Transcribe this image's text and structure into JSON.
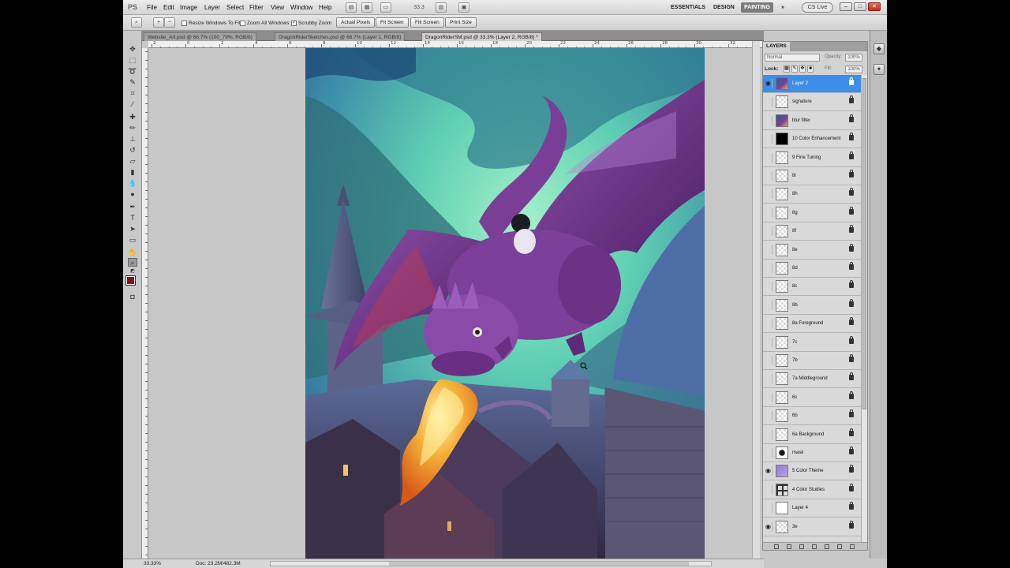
{
  "app": {
    "logo": "PS"
  },
  "menu": [
    "File",
    "Edit",
    "Image",
    "Layer",
    "Select",
    "Filter",
    "View",
    "Window",
    "Help"
  ],
  "zoom_menu_value": "33.3",
  "workspaces": [
    "ESSENTIALS",
    "DESIGN",
    "PAINTING"
  ],
  "workspace_more": "»",
  "cs_live": "CS Live",
  "window_controls": {
    "min": "–",
    "max": "□",
    "close": "✕"
  },
  "options": {
    "resize_windows": "Resize Windows To Fit",
    "zoom_all": "Zoom All Windows",
    "scrubby_zoom": "Scrubby Zoom",
    "actual_pixels": "Actual Pixels",
    "fit_screen": "Fit Screen",
    "fill_screen": "Fill Screen",
    "print_size": "Print Size"
  },
  "tabs": [
    {
      "label": "Website_Art.psd @ 66.7% (100_79%, RGB/8)",
      "active": false
    },
    {
      "label": "DragonRiderSketches.psd @ 66.7% (Layer 1, RGB/8)",
      "active": false
    },
    {
      "label": "DragonRiderSM.psd @ 33.3% (Layer 2, RGB/8) *",
      "active": true
    }
  ],
  "ruler_labels": [
    "2",
    "0",
    "2",
    "4",
    "6",
    "8",
    "10",
    "12",
    "14",
    "16",
    "18",
    "20",
    "22",
    "24",
    "26",
    "28",
    "30",
    "32"
  ],
  "status": {
    "zoom": "33.33%",
    "doc": "Doc: 23.2M/482.3M"
  },
  "layers_panel": {
    "tab": "LAYERS",
    "blend_mode": "Normal",
    "opacity_label": "Opacity:",
    "opacity": "100%",
    "lock_label": "Lock:",
    "fill_label": "Fill:",
    "fill": "100%",
    "layers": [
      {
        "name": "Layer 2",
        "visible": true,
        "selected": true,
        "thumb": "art"
      },
      {
        "name": "signature",
        "visible": false,
        "thumb": "empty"
      },
      {
        "name": "blur filter",
        "visible": false,
        "thumb": "art"
      },
      {
        "name": "10 Color Enhancement",
        "visible": false,
        "thumb": "black"
      },
      {
        "name": "9 Fine Tuning",
        "visible": false,
        "thumb": "empty"
      },
      {
        "name": "8i",
        "visible": false,
        "thumb": "empty"
      },
      {
        "name": "8h",
        "visible": false,
        "thumb": "empty"
      },
      {
        "name": "8g",
        "visible": false,
        "thumb": "empty"
      },
      {
        "name": "8f",
        "visible": false,
        "thumb": "empty"
      },
      {
        "name": "8e",
        "visible": false,
        "thumb": "empty"
      },
      {
        "name": "8d",
        "visible": false,
        "thumb": "empty"
      },
      {
        "name": "8c",
        "visible": false,
        "thumb": "empty"
      },
      {
        "name": "8b",
        "visible": false,
        "thumb": "empty"
      },
      {
        "name": "8a Foreground",
        "visible": false,
        "thumb": "empty"
      },
      {
        "name": "7c",
        "visible": false,
        "thumb": "empty"
      },
      {
        "name": "7b",
        "visible": false,
        "thumb": "empty"
      },
      {
        "name": "7a Middleground",
        "visible": false,
        "thumb": "empty"
      },
      {
        "name": "6c",
        "visible": false,
        "thumb": "empty"
      },
      {
        "name": "6b",
        "visible": false,
        "thumb": "empty"
      },
      {
        "name": "6a Background",
        "visible": false,
        "thumb": "empty"
      },
      {
        "name": "mask",
        "visible": false,
        "thumb": "mask"
      },
      {
        "name": "5 Color Theme",
        "visible": true,
        "thumb": "purple"
      },
      {
        "name": "4 Color Studies",
        "visible": false,
        "thumb": "grid"
      },
      {
        "name": "Layer 4",
        "visible": false,
        "thumb": "white"
      },
      {
        "name": "3e",
        "visible": true,
        "thumb": "empty"
      }
    ]
  },
  "colors": {
    "foreground": "#8c1010",
    "background": "#ffffff",
    "selection": "#3d8ee8"
  }
}
